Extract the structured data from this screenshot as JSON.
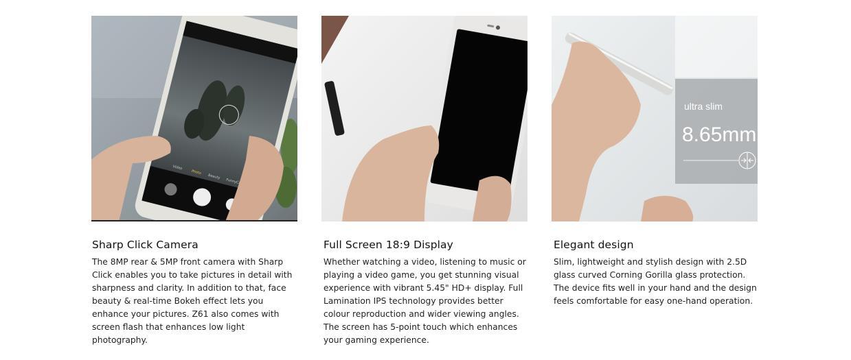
{
  "features": [
    {
      "heading": "Sharp Click Camera",
      "description": "The 8MP rear & 5MP front camera with Sharp Click enables you to take pictures in detail with sharpness and clarity. In addition to that, face beauty & real-time Bokeh effect lets you enhance your pictures. Z61 also comes with screen flash that enhances low light photography.",
      "image_alt": "hand-holding-phone-camera-photo",
      "camera_modes": [
        "Video",
        "Photo",
        "Beauty",
        "FunnyCam"
      ]
    },
    {
      "heading": "Full Screen 18:9 Display",
      "description": "Whether watching a video, listening to music or playing a video game, you get stunning visual experience with vibrant 5.45\" HD+ display. Full Lamination IPS technology provides better colour reproduction and wider viewing angles. The screen has 5-point touch which enhances your gaming experience.",
      "image_alt": "hands-holding-phone-display-photo"
    },
    {
      "heading": "Elegant design",
      "description": "Slim, lightweight and stylish design with 2.5D glass curved Corning Gorilla glass protection. The device fits well in your hand and the design feels comfortable for easy one-hand operation.",
      "image_alt": "hand-holding-slim-phone-photo",
      "overlay_label": "ultra slim",
      "overlay_value": "8.65mm"
    }
  ],
  "colors": {
    "background": "#ffffff",
    "text": "#222222"
  }
}
